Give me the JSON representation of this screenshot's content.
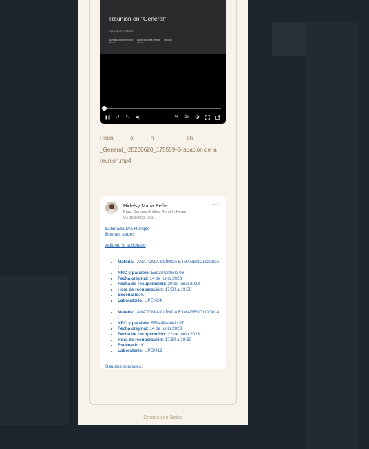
{
  "video": {
    "title": "Reunión en \"General\"",
    "date": "2023-06-20 23:56 UTC",
    "participants": [
      {
        "name": "Barbara Andrea Rengifo",
        "role": "Heras"
      },
      {
        "name": "Barbara Andrea Rengifo",
        "role": "Heras"
      },
      {
        "name": "Optional",
        "role": ""
      }
    ],
    "speed": "1x"
  },
  "filename": {
    "line1": "Reuni          ó           n                     en",
    "line2": "_General_-20230620_175559-Grabación de la",
    "line3": "reunión.mp4"
  },
  "email": {
    "sender": "Hidelsy Maria Peña",
    "to": "Para: Barbara Andrea Rengifo Heras",
    "date": "Vie 16/6/2023 13:11",
    "greeting": "Estimada Dra Rengifo",
    "greeting2": "Buenas tardes",
    "intro": "Adjunto lo solicitado",
    "block1": [
      {
        "label": "Materia:",
        "value": "ANATOMÍA CLÍNICA E IMAGENOLÓGICA I"
      },
      {
        "label": "NRC y paralelo:",
        "value": "5593/Paralelo 96"
      },
      {
        "label": "Fecha original:",
        "value": "14 de junio 2023"
      },
      {
        "label": "Fecha de recuperación:",
        "value": "20 de junio 2023"
      },
      {
        "label": "Hora de recuperación:",
        "value": "17:50 a 19:50"
      },
      {
        "label": "Escenario:",
        "value": "K"
      },
      {
        "label": "Laboratorio:",
        "value": "UPE/424"
      }
    ],
    "block2": [
      {
        "label": "Materia:",
        "value": "ANATOMÍA CLÍNICA E IMAGENOLÓGICA I"
      },
      {
        "label": "NRC y paralelo:",
        "value": "5594/Paralelo 97"
      },
      {
        "label": "Fecha original:",
        "value": "14 de junio 2023"
      },
      {
        "label": "Fecha de recuperación:",
        "value": "22 de junio 2023"
      },
      {
        "label": "Hora de recuperación:",
        "value": "17:50 a 19:50"
      },
      {
        "label": "Escenario:",
        "value": "K"
      },
      {
        "label": "Laboratorio:",
        "value": "UPO/413"
      }
    ],
    "closing": "Saludos cordiales,"
  },
  "footer": "Creado con Notas",
  "colors": {
    "page_bg": "#1d252c",
    "panel_bg": "#f7f3ea",
    "link": "#1e5ea6",
    "filename": "#8d7452"
  }
}
